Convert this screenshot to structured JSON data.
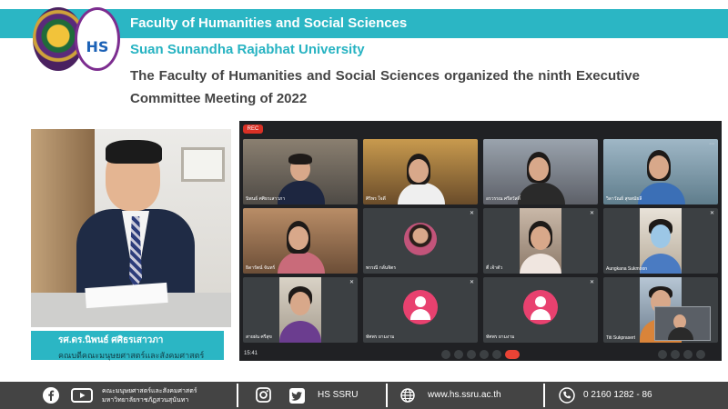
{
  "header": {
    "faculty": "Faculty of Humanities and Social Sciences",
    "university": "Suan Sunandha Rajabhat University",
    "headline": "The Faculty of Humanities and Social Sciences organized the ninth Executive Committee Meeting of 2022",
    "logo_text": "HS"
  },
  "portrait": {
    "name": "รศ.ดร.นิพนธ์ ศศิธรเสาวภา",
    "position": "คณบดีคณะมนุษยศาสตร์และสังคมศาสตร์"
  },
  "meeting": {
    "rec_label": "REC",
    "time": "15:41",
    "tiles": [
      {
        "label": "นิพนธ์ ศศิธรเสาวภา"
      },
      {
        "label": "ศิริพร ใจดี"
      },
      {
        "label": "อรวรรณ ศรีสวัสดิ์"
      },
      {
        "label": "วิลาวัณย์ สุขสมัยลี"
      },
      {
        "label": "ธิดารัตน์ จันทร์"
      },
      {
        "label": "พรรณี กลั่นจิตร"
      },
      {
        "label": "ตี่ เจ้าตัว"
      },
      {
        "label": "Aungkana Sukmoon"
      },
      {
        "label": "สายฝน ศรีสุข"
      },
      {
        "label": "ทัศพร ยามงาม"
      },
      {
        "label": "ทัศพร ยามงาม"
      },
      {
        "label": "Titi Sukprasert"
      }
    ]
  },
  "footer": {
    "org_line1": "คณะมนุษยศาสตร์และสังคมศาสตร์",
    "org_line2": "มหาวิทยาลัยราชภัฏสวนสุนันทา",
    "social_handle": "HS SSRU",
    "website": "www.hs.ssru.ac.th",
    "phone": "0  2160 1282 - 86",
    "icons": [
      "facebook-icon",
      "youtube-icon",
      "instagram-icon",
      "twitter-icon",
      "globe-icon",
      "phone-icon"
    ]
  },
  "colors": {
    "accent": "#2bb6c4",
    "footer_bg": "#444444",
    "meet_bg": "#202124",
    "avatar_pink": "#e8416f"
  }
}
